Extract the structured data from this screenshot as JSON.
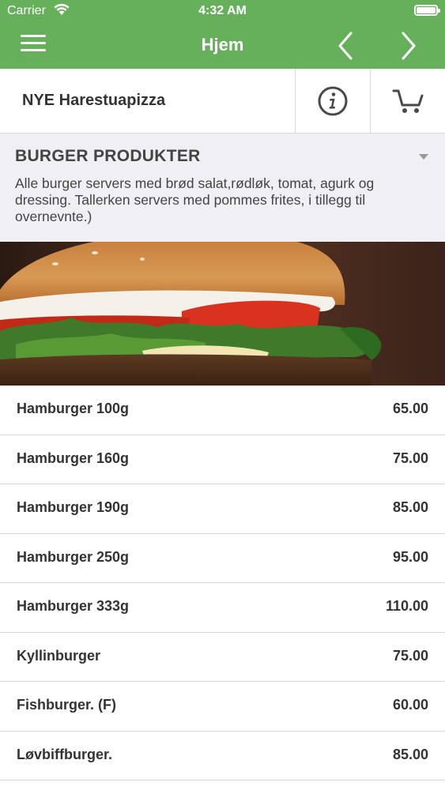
{
  "status_bar": {
    "carrier": "Carrier",
    "time": "4:32 AM"
  },
  "navbar": {
    "title": "Hjem",
    "menu_icon": "hamburger-menu-icon",
    "back_icon": "chevron-left-icon",
    "forward_icon": "chevron-right-icon"
  },
  "restaurant": {
    "name": "NYE Harestuapizza",
    "info_icon": "info-icon",
    "cart_icon": "cart-icon"
  },
  "category": {
    "title": "BURGER PRODUKTER",
    "description": "Alle burger servers med brød salat,rødløk, tomat, agurk og dressing. Tallerken servers med pommes frites, i tillegg til overnevnte.)",
    "toggle_icon": "caret-down-icon"
  },
  "items": [
    {
      "name": "Hamburger 100g",
      "price": "65.00"
    },
    {
      "name": "Hamburger 160g",
      "price": "75.00"
    },
    {
      "name": "Hamburger 190g",
      "price": "85.00"
    },
    {
      "name": "Hamburger 250g",
      "price": "95.00"
    },
    {
      "name": "Hamburger 333g",
      "price": "110.00"
    },
    {
      "name": "Kyllinburger",
      "price": "75.00"
    },
    {
      "name": "Fishburger. (F)",
      "price": "60.00"
    },
    {
      "name": "Løvbiffburger.",
      "price": "85.00"
    }
  ],
  "colors": {
    "brand_green": "#66b05c",
    "section_background": "#efeff4"
  }
}
